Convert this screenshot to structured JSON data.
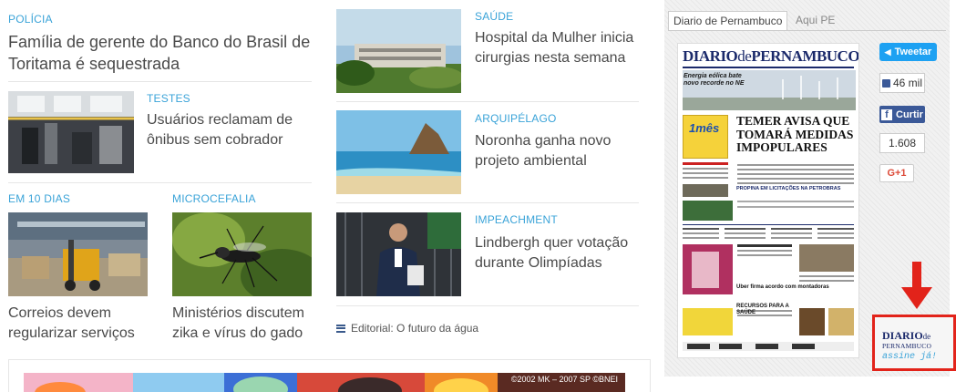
{
  "left_col": {
    "story1": {
      "category": "POLÍCIA",
      "title": "Família de gerente do Banco do Brasil de Toritama é sequestrada"
    },
    "story2": {
      "category": "TESTES",
      "title": "Usuários reclamam de ônibus sem cobrador"
    },
    "story3": {
      "category": "EM 10 DIAS",
      "title": "Correios devem regularizar serviços"
    },
    "story4": {
      "category": "MICROCEFALIA",
      "title": "Ministérios discutem zika e vírus do gado"
    }
  },
  "mid_col": {
    "story1": {
      "category": "SAÚDE",
      "title": "Hospital da Mulher inicia cirurgias nesta semana"
    },
    "story2": {
      "category": "ARQUIPÉLAGO",
      "title": "Noronha ganha novo projeto ambiental"
    },
    "story3": {
      "category": "IMPEACHMENT",
      "title": "Lindbergh quer votação durante Olimpíadas"
    },
    "editorial": {
      "icon": "list-icon",
      "text": "Editorial: O futuro da água"
    }
  },
  "banner": {
    "copyright": "©2002 MK – 2007 SP ©BNEI"
  },
  "sidebar": {
    "tabs": [
      {
        "label": "Diario de Pernambuco",
        "active": true
      },
      {
        "label": "Aqui PE",
        "active": false
      }
    ],
    "newspaper": {
      "masthead_a": "DIARIO",
      "masthead_b": "de",
      "masthead_c": "PERNAMBUCO",
      "headline": "TEMER AVISA QUE TOMARÁ MEDIDAS IMPOPULARES",
      "sub_headline": "Energia eólica bate novo recorde no NE",
      "promo_label": "1mês",
      "petrobras": "PROPINA EM LICITAÇÕES NA PETROBRAS",
      "uber": "Uber firma acordo com montadoras",
      "recursos": "RECURSOS PARA A SAÚDE"
    },
    "social": {
      "tweet_label": "Tweetar",
      "like_count": "46 mil",
      "share_label": "Curtir",
      "share_count": "1.608",
      "gplus_label": "G+1"
    },
    "subscribe": {
      "logo_a": "DIARIO",
      "logo_b": "de",
      "logo_c": "PERNAMBUCO",
      "cta": "assine já!"
    },
    "colors": {
      "accent": "#3aa3d8",
      "highlight": "#e2231a",
      "twitter": "#1da1f2",
      "facebook": "#3b5998"
    }
  }
}
